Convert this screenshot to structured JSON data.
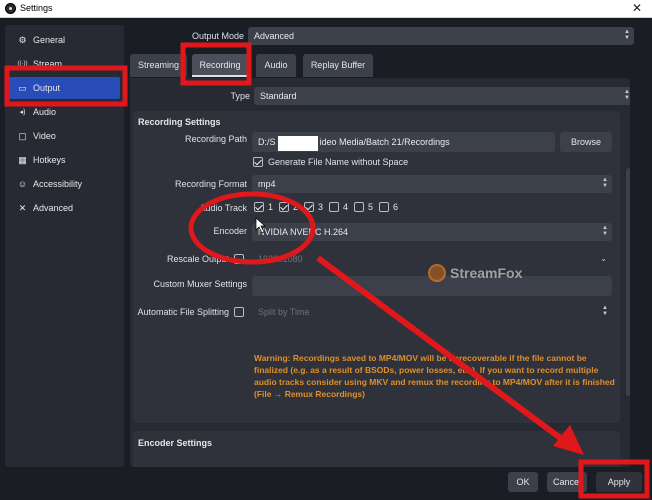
{
  "window": {
    "title": "Settings",
    "close_glyph": "✕"
  },
  "sidebar": {
    "items": [
      {
        "label": "General",
        "icon": "gear-icon",
        "glyph": "⚙"
      },
      {
        "label": "Stream",
        "icon": "stream-icon",
        "glyph": "((·))"
      },
      {
        "label": "Output",
        "icon": "output-icon",
        "glyph": "▭"
      },
      {
        "label": "Audio",
        "icon": "speaker-icon",
        "glyph": "◂)"
      },
      {
        "label": "Video",
        "icon": "monitor-icon",
        "glyph": "▢"
      },
      {
        "label": "Hotkeys",
        "icon": "keyboard-icon",
        "glyph": "▦"
      },
      {
        "label": "Accessibility",
        "icon": "accessibility-icon",
        "glyph": "☺"
      },
      {
        "label": "Advanced",
        "icon": "wrench-icon",
        "glyph": "✕"
      }
    ],
    "active": "Output"
  },
  "output_mode": {
    "label": "Output Mode",
    "value": "Advanced"
  },
  "tabs": [
    "Streaming",
    "Recording",
    "Audio",
    "Replay Buffer"
  ],
  "active_tab": "Recording",
  "type": {
    "label": "Type",
    "value": "Standard"
  },
  "recording_settings": {
    "title": "Recording Settings",
    "path": {
      "label": "Recording Path",
      "value_prefix": "D:/S",
      "value_suffix": "ideo Media/Batch 21/Recordings",
      "browse": "Browse"
    },
    "gen_filename": {
      "label": "Generate File Name without Space",
      "checked": true
    },
    "format": {
      "label": "Recording Format",
      "value": "mp4"
    },
    "audio_track": {
      "label": "Audio Track",
      "tracks": [
        {
          "num": "1",
          "checked": true
        },
        {
          "num": "2",
          "checked": true
        },
        {
          "num": "3",
          "checked": true
        },
        {
          "num": "4",
          "checked": false
        },
        {
          "num": "5",
          "checked": false
        },
        {
          "num": "6",
          "checked": false
        }
      ]
    },
    "encoder": {
      "label": "Encoder",
      "value": "NVIDIA NVENC H.264"
    },
    "rescale": {
      "label": "Rescale Output",
      "value": "1920x1080",
      "checked": false
    },
    "muxer": {
      "label": "Custom Muxer Settings",
      "value": ""
    },
    "split": {
      "label": "Automatic File Splitting",
      "value": "Split by Time",
      "checked": false
    },
    "warning": "Warning: Recordings saved to MP4/MOV will be unrecoverable if the file cannot be finalized (e.g. as a result of BSODs, power losses, etc.). If you want to record multiple audio tracks consider using MKV and remux the recording to MP4/MOV after it is finished (File → Remux Recordings)"
  },
  "encoder_settings": {
    "title": "Encoder Settings"
  },
  "watermark": {
    "text": "StreamFox"
  },
  "buttons": {
    "ok": "OK",
    "cancel": "Cancel",
    "apply": "Apply"
  },
  "colors": {
    "accent": "#284cb8",
    "annotation_red": "#e0181c",
    "warning": "#e08f2a"
  }
}
